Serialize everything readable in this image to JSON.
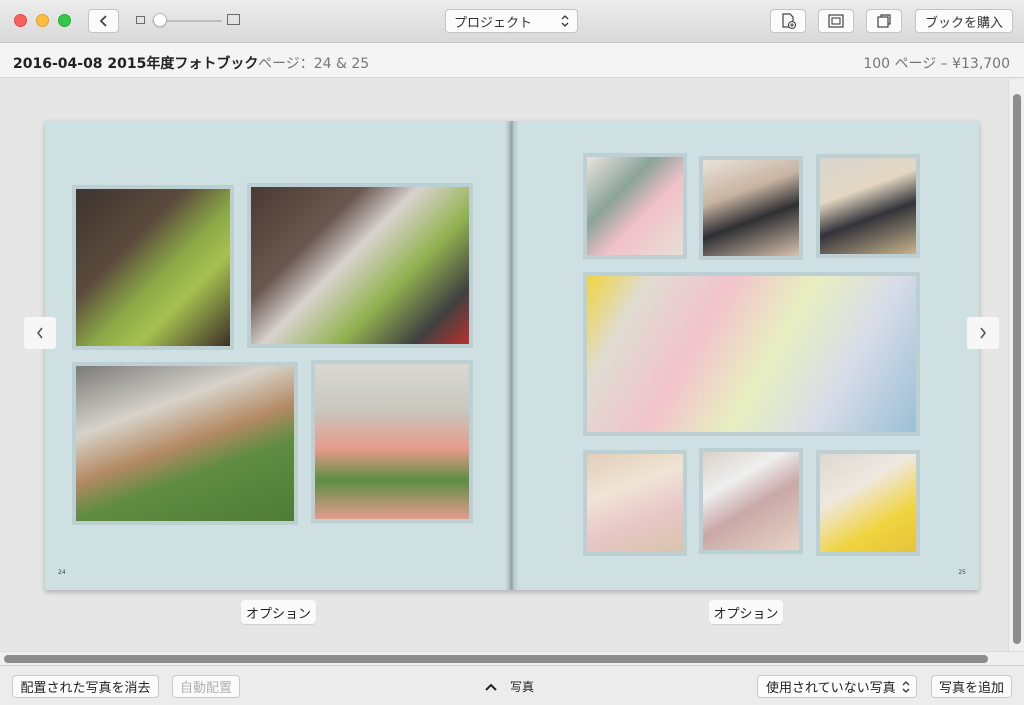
{
  "toolbar": {
    "project_label": "プロジェクト",
    "buy_label": "ブックを購入"
  },
  "infobar": {
    "title": "2016-04-08 2015年度フォトブック",
    "page_info": "ページ：24 & 25",
    "price_info": "100 ページ – ¥13,700"
  },
  "spread": {
    "left_page_number": "24",
    "right_page_number": "25",
    "options_left": "オプション",
    "options_right": "オプション"
  },
  "bottombar": {
    "clear_label": "配置された写真を消去",
    "auto_label": "自動配置",
    "photos_label": "写真",
    "unused_label": "使用されていない写真",
    "add_label": "写真を追加"
  },
  "colors": {
    "page_bg": "#cfe0e3",
    "canvas_bg": "#e6e6e6",
    "close": "#fc605c",
    "minimize": "#fdbc40",
    "maximize": "#34c84a"
  }
}
